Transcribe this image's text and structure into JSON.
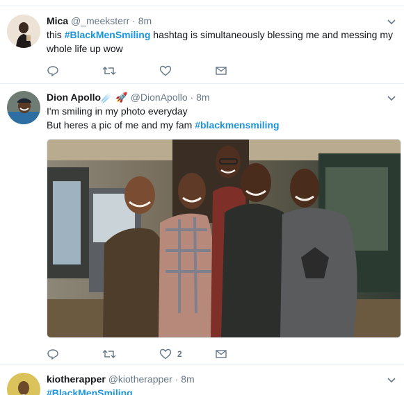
{
  "tweets": [
    {
      "name": "Mica",
      "handle": "@_meeksterr",
      "dot": "·",
      "time": "8m",
      "text_before": "this ",
      "hashtag": "#BlackMenSmiling",
      "text_after": " hashtag is simultaneously blessing me and messing my whole life up wow"
    },
    {
      "name": "Dion Apollo",
      "emoji": "☄️ 🚀",
      "handle": "@DionApollo",
      "dot": "·",
      "time": "8m",
      "line1": "I'm smiling in my photo everyday",
      "line2_before": "But heres a pic of me and my fam ",
      "hashtag": "#blackmensmiling",
      "like_count": "2"
    },
    {
      "name": "kiotherapper",
      "handle": "@kiotherapper",
      "dot": "·",
      "time": "8m",
      "hashtag": "#BlackMenSmiling"
    }
  ],
  "icons": {
    "reply": "reply-icon",
    "retweet": "retweet-icon",
    "like": "like-icon",
    "dm": "direct-message-icon",
    "caret": "chevron-down-icon"
  },
  "colors": {
    "link": "#1b95e0",
    "muted": "#657786",
    "divider": "#e6ecf0"
  }
}
